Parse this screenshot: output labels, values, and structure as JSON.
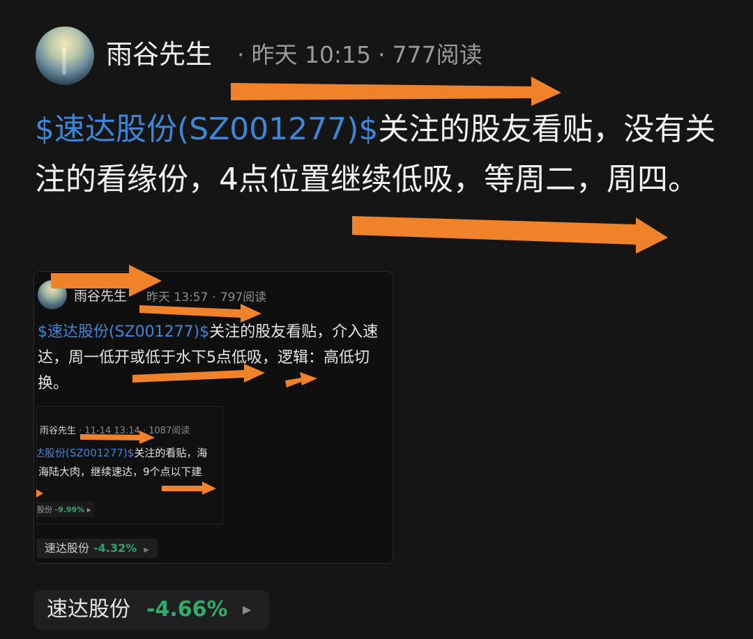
{
  "post": {
    "author": "雨谷先生",
    "time": "昨天 10:15",
    "reads": "777阅读",
    "stock_link": "$速达股份(SZ001277)$",
    "text_rest": "关注的股友看贴，没有关注的看缘份，4点位置继续低吸，等周二，周四。"
  },
  "quote1": {
    "author": "雨谷先生",
    "time": "昨天 13:57",
    "reads": "797阅读",
    "stock_link": "$速达股份(SZ001277)$",
    "text_rest": "关注的股友看贴，介入速达，周一低开或低于水下5点低吸，逻辑：高低切换。"
  },
  "quote2": {
    "author": "雨谷先生",
    "time": "11-14 13:14",
    "reads": "1087阅读",
    "line1_link": "达股份(SZ001277)$",
    "line1_rest": "关注的看贴，海",
    "line2": "海陆大肉，继续速达，9个点以下建",
    "chip_name": "股份",
    "chip_pct": "-9.99%"
  },
  "quote1_chip": {
    "name": "速达股份",
    "pct": "-4.32%"
  },
  "stock_chip": {
    "name": "速达股份",
    "pct": "-4.66%"
  },
  "icons": {
    "chevron": "chevron-right-icon"
  },
  "colors": {
    "link": "#3f86d8",
    "down": "#2fae6a",
    "arrow": "#f0832a",
    "background": "#151516"
  }
}
